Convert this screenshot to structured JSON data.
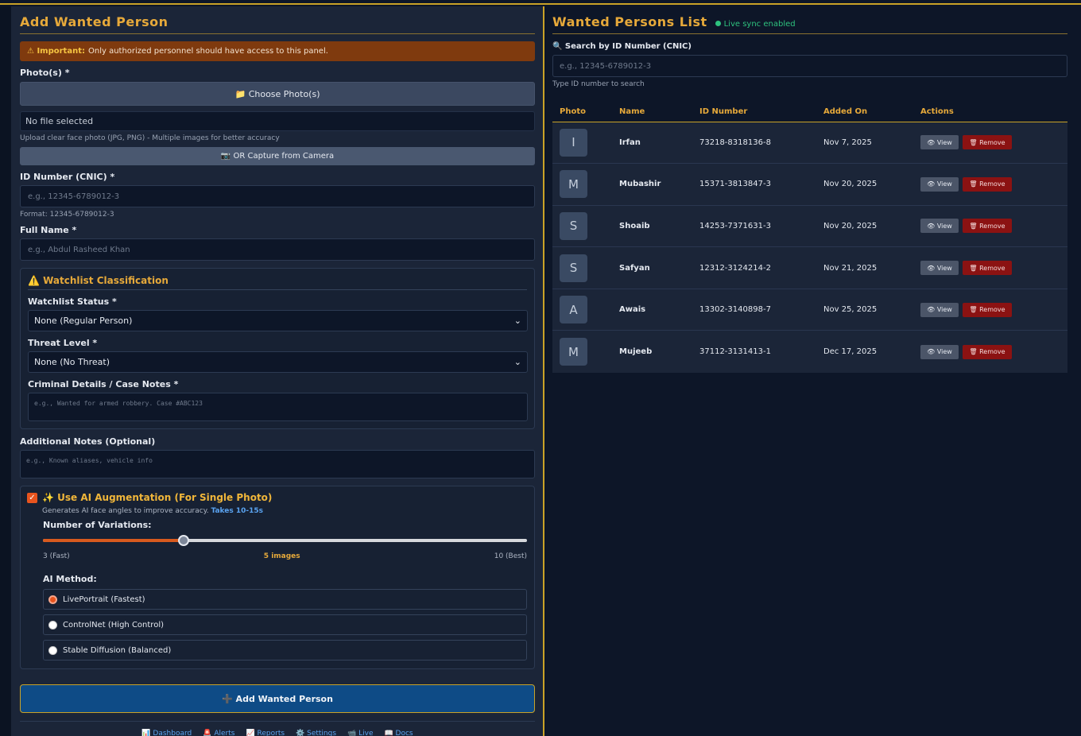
{
  "add_form": {
    "title": "Add Wanted Person",
    "alert_strong": "⚠ Important:",
    "alert_text": "Only authorized personnel should have access to this panel.",
    "photos_label": "Photo(s) *",
    "choose_photo_label": "📁 Choose Photo(s)",
    "file_status": "No file selected",
    "photo_hint": "Upload clear face photo (JPG, PNG) - Multiple images for better accuracy",
    "camera_label": "📷 OR Capture from Camera",
    "id_label": "ID Number (CNIC) *",
    "id_placeholder": "e.g., 12345-6789012-3",
    "id_hint": "Format: 12345-6789012-3",
    "name_label": "Full Name *",
    "name_placeholder": "e.g., Abdul Rasheed Khan",
    "watchlist": {
      "title": "⚠️ Watchlist Classification",
      "status_label": "Watchlist Status *",
      "status_value": "None (Regular Person)",
      "threat_label": "Threat Level *",
      "threat_value": "None (No Threat)",
      "details_label": "Criminal Details / Case Notes *",
      "details_placeholder": "e.g., Wanted for armed robbery. Case #ABC123"
    },
    "notes_label": "Additional Notes (Optional)",
    "notes_placeholder": "e.g., Known aliases, vehicle info",
    "ai": {
      "enabled": true,
      "title": "✨ Use AI Augmentation (For Single Photo)",
      "subtitle": "Generates AI face angles to improve accuracy.",
      "subtitle_strong": "Takes 10-15s",
      "variations_label": "Number of Variations:",
      "slider_min": 3,
      "slider_max": 10,
      "slider_value": 5,
      "scale_min_label": "3 (Fast)",
      "scale_value_label": "5 images",
      "scale_max_label": "10 (Best)",
      "method_label": "AI Method:",
      "methods": [
        {
          "label": "LivePortrait (Fastest)",
          "selected": true
        },
        {
          "label": "ControlNet (High Control)",
          "selected": false
        },
        {
          "label": "Stable Diffusion (Balanced)",
          "selected": false
        }
      ]
    },
    "submit_label": "➕ Add Wanted Person"
  },
  "footer_links": [
    "📊 Dashboard",
    "🚨 Alerts",
    "📈 Reports",
    "⚙️ Settings",
    "📹 Live",
    "📖 Docs"
  ],
  "list": {
    "title": "Wanted Persons List",
    "sync_label": "Live sync enabled",
    "search_label": "🔍 Search by ID Number (CNIC)",
    "search_placeholder": "e.g., 12345-6789012-3",
    "search_hint": "Type ID number to search",
    "columns": [
      "Photo",
      "Name",
      "ID Number",
      "Added On",
      "Actions"
    ],
    "view_label": "👁 View",
    "remove_label": "🗑 Remove",
    "rows": [
      {
        "initial": "I",
        "name": "Irfan",
        "id": "73218-8318136-8",
        "added": "Nov 7, 2025"
      },
      {
        "initial": "M",
        "name": "Mubashir",
        "id": "15371-3813847-3",
        "added": "Nov 20, 2025"
      },
      {
        "initial": "S",
        "name": "Shoaib",
        "id": "14253-7371631-3",
        "added": "Nov 20, 2025"
      },
      {
        "initial": "S",
        "name": "Safyan",
        "id": "12312-3124214-2",
        "added": "Nov 21, 2025"
      },
      {
        "initial": "A",
        "name": "Awais",
        "id": "13302-3140898-7",
        "added": "Nov 25, 2025"
      },
      {
        "initial": "M",
        "name": "Mujeeb",
        "id": "37112-3131413-1",
        "added": "Dec 17, 2025"
      }
    ]
  },
  "colors": {
    "accent": "#e6a93a",
    "danger": "#8b1212",
    "primary": "#0e4b86",
    "live": "#2ec27e"
  }
}
